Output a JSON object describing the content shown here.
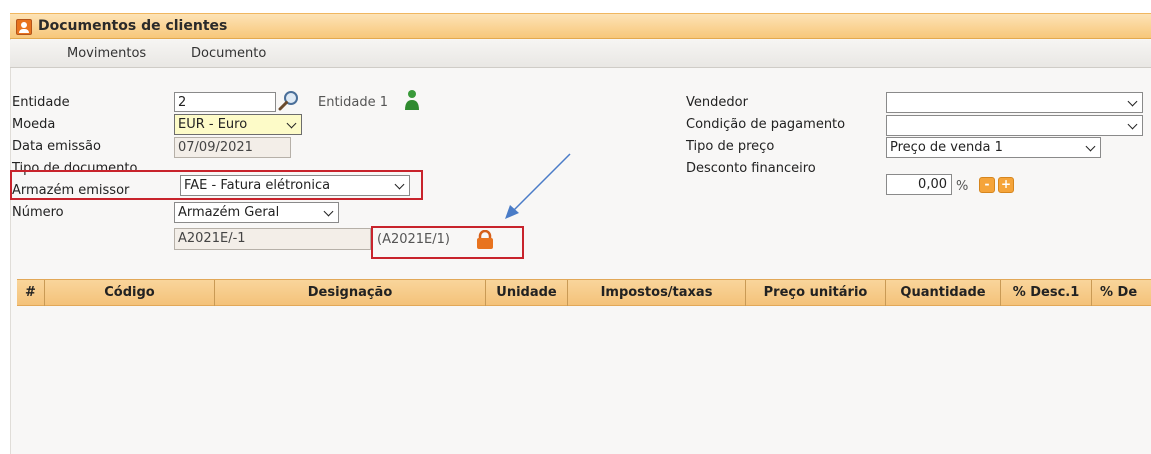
{
  "window": {
    "title": "Documentos de clientes"
  },
  "menu": {
    "items": [
      "Movimentos",
      "Documento"
    ]
  },
  "form_left": {
    "entidade": {
      "label": "Entidade",
      "value": "2",
      "name": "Entidade 1"
    },
    "moeda": {
      "label": "Moeda",
      "value": "EUR - Euro"
    },
    "data_emissao": {
      "label": "Data emissão",
      "value": "07/09/2021"
    },
    "tipo_documento": {
      "label": "Tipo de documento",
      "value": "FAE - Fatura elétronica"
    },
    "armazem": {
      "label": "Armazém emissor",
      "value": "Armazém Geral"
    },
    "numero": {
      "label": "Número",
      "value": "A2021E/-1",
      "locked_value": "(A2021E/1)"
    }
  },
  "form_right": {
    "vendedor": {
      "label": "Vendedor",
      "value": ""
    },
    "condicao": {
      "label": "Condição de pagamento",
      "value": ""
    },
    "tipo_preco": {
      "label": "Tipo de preço",
      "value": "Preço de venda 1"
    },
    "desconto": {
      "label": "Desconto financeiro",
      "value": "0,00",
      "unit": "%",
      "minus": "-",
      "plus": "+"
    }
  },
  "grid": {
    "columns": [
      "#",
      "Código",
      "Designação",
      "Unidade",
      "Impostos/taxas",
      "Preço unitário",
      "Quantidade",
      "% Desc.1",
      "% De"
    ]
  },
  "colors": {
    "header_orange": "#f7c77a",
    "highlight_red": "#c8232c",
    "arrow_blue": "#4a7cc7",
    "readonly_bg": "#f3eee8",
    "currency_bg": "#fdfbc8"
  },
  "icons": {
    "window": "customer-documents-icon",
    "search": "search-icon",
    "entity": "person-icon",
    "lock": "lock-icon"
  }
}
